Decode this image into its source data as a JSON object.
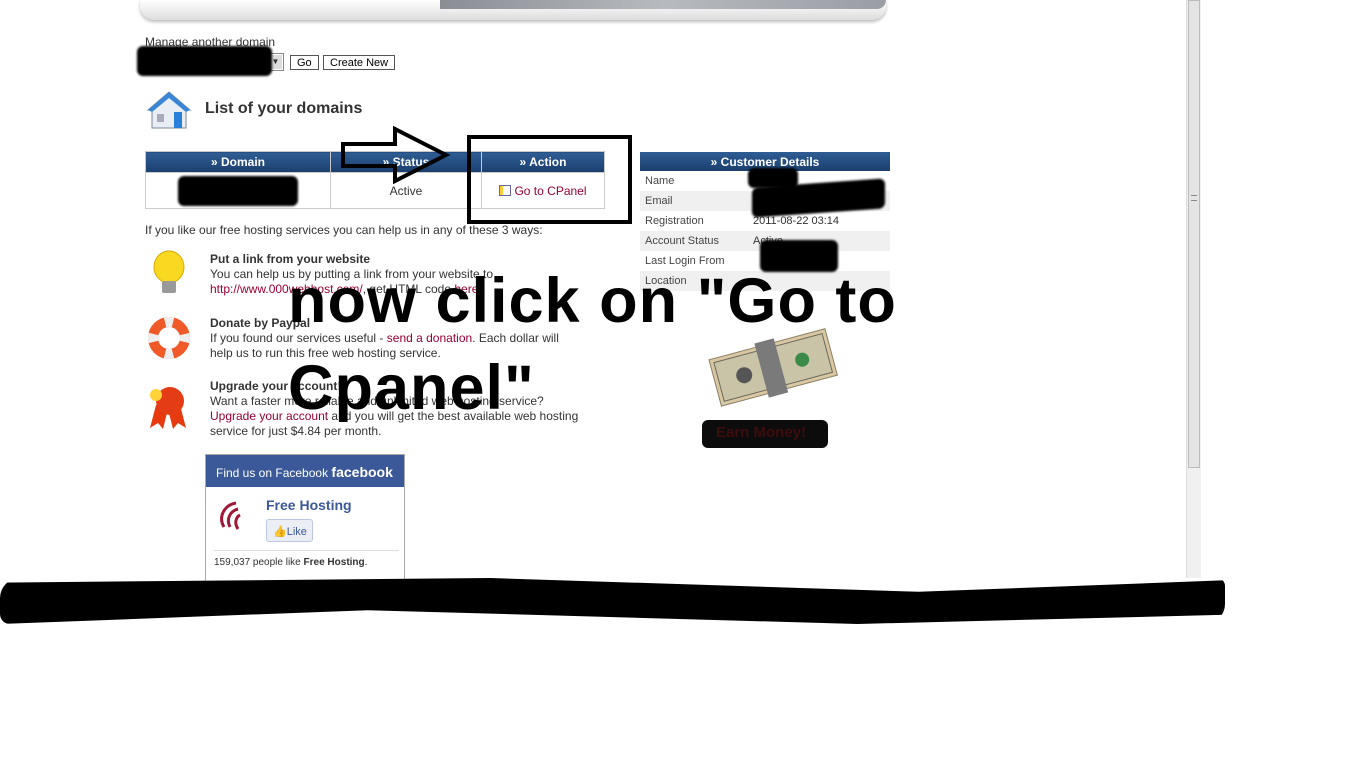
{
  "manage": {
    "label": "Manage another domain",
    "go": "Go",
    "create": "Create New"
  },
  "section_title": "List of your domains",
  "domains_table": {
    "headers": [
      "» Domain",
      "» Status",
      "» Action"
    ],
    "rows": [
      {
        "domain": "",
        "status": "Active",
        "action": "Go to CPanel"
      }
    ]
  },
  "customer": {
    "title": "» Customer Details",
    "rows": [
      {
        "label": "Name",
        "value": ""
      },
      {
        "label": "Email",
        "value": ""
      },
      {
        "label": "Registration",
        "value": "2011-08-22 03:14"
      },
      {
        "label": "Account Status",
        "value": "Active"
      },
      {
        "label": "Last Login From",
        "value": ""
      },
      {
        "label": "Location",
        "value": ""
      }
    ]
  },
  "help_intro": "If you like our free hosting services you can help us in any of these 3 ways:",
  "ways": [
    {
      "icon": "lightbulb-icon",
      "title": "Put a link from your website",
      "text1": "You can help us by putting a link from your website to",
      "link": "http://www.000webhost.com/",
      "text2": ", get HTML code ",
      "link2": "here"
    },
    {
      "icon": "lifebuoy-icon",
      "title": "Donate by Paypal",
      "text1": "If you found our services useful - ",
      "link": "send a donation",
      "text2": ". Each dollar will help us to run this free web hosting service."
    },
    {
      "icon": "award-ribbon-icon",
      "title": "Upgrade your account!",
      "text1": "Want a faster more reliable and unlimited web hosting service? ",
      "link": "Upgrade your account",
      "text2": " and you will get the best available web hosting service for just $4.84 per month."
    }
  ],
  "facebook": {
    "header": "Find us on Facebook",
    "logo": "facebook",
    "page": "Free Hosting",
    "like": "Like",
    "count_text": "159,037 people like ",
    "count_page": "Free Hosting",
    "period": "."
  },
  "earn": "Earn Money!",
  "annotation": {
    "line1": "now click on \"Go to",
    "line2": "Cpanel\""
  }
}
